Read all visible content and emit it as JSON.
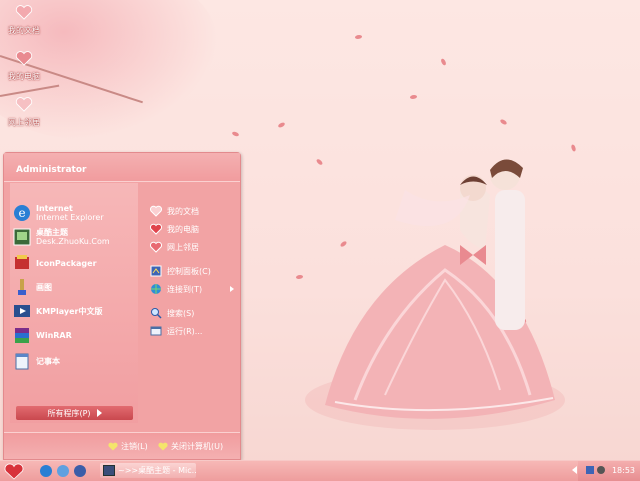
{
  "desktop": {
    "icons": [
      {
        "label": "我的文档",
        "icon": "heart-folder-icon"
      },
      {
        "label": "我的电脑",
        "icon": "heart-computer-icon"
      },
      {
        "label": "网上邻居",
        "icon": "heart-network-icon"
      }
    ]
  },
  "start_menu": {
    "user": "Administrator",
    "pinned": [
      {
        "title": "Internet",
        "subtitle": "Internet Explorer",
        "icon": "internet-explorer-icon"
      },
      {
        "title": "桌酷主题",
        "subtitle": "Desk.ZhuoKu.Com",
        "icon": "zhuoku-theme-icon"
      }
    ],
    "recent": [
      {
        "title": "IconPackager",
        "icon": "iconpackager-icon"
      },
      {
        "title": "画图",
        "icon": "paint-icon"
      },
      {
        "title": "KMPlayer中文版",
        "icon": "kmplayer-icon"
      },
      {
        "title": "WinRAR",
        "icon": "winrar-icon"
      },
      {
        "title": "记事本",
        "icon": "notepad-icon"
      }
    ],
    "all_programs": "所有程序(P)",
    "right": [
      {
        "label": "我的文档",
        "icon": "heart-documents-icon"
      },
      {
        "label": "我的电脑",
        "icon": "heart-computer-icon"
      },
      {
        "label": "网上邻居",
        "icon": "heart-network-icon"
      },
      {
        "label": "控制面板(C)",
        "icon": "control-panel-icon"
      },
      {
        "label": "连接到(T)",
        "icon": "connect-to-icon"
      },
      {
        "label": "搜索(S)",
        "icon": "search-icon"
      },
      {
        "label": "运行(R)...",
        "icon": "run-icon"
      }
    ],
    "logoff": "注销(L)",
    "shutdown": "关闭计算机(U)"
  },
  "taskbar": {
    "task_label": "~>>桌酷主题 - Mic...",
    "clock": "18:53"
  },
  "colors": {
    "accent": "#f19c9e",
    "heart": "#e0444c"
  }
}
